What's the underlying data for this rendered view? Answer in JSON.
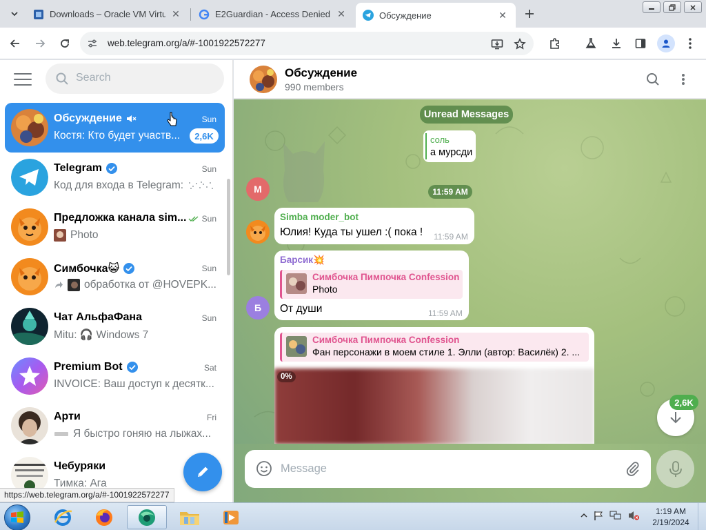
{
  "browser": {
    "tabs": [
      {
        "title": "Downloads – Oracle VM Virtua"
      },
      {
        "title": "E2Guardian - Access Denied"
      },
      {
        "title": "Обсуждение"
      }
    ],
    "url": "web.telegram.org/a/#-1001922572277",
    "status_url": "https://web.telegram.org/a/#-1001922572277"
  },
  "sidebar": {
    "search_placeholder": "Search",
    "chats": [
      {
        "name": "Обсуждение",
        "date": "Sun",
        "preview": "Костя: Кто будет участв...",
        "badge": "2,6K",
        "active": true
      },
      {
        "name": "Telegram",
        "date": "Sun",
        "preview": "Код для входа в Telegram:"
      },
      {
        "name": "Предложка канала sim...",
        "date": "Sun",
        "preview": "Photo"
      },
      {
        "name": "Симбочка😺",
        "date": "Sun",
        "preview": "обработка от @HOVEPK..."
      },
      {
        "name": "Чат АльфаФана",
        "date": "Sun",
        "preview": "Mitu: 🎧 Windows 7"
      },
      {
        "name": "Premium Bot",
        "date": "Sat",
        "preview": "INVOICE: Ваш доступ к десятк..."
      },
      {
        "name": "Арти",
        "date": "Fri",
        "preview": "Я быстро гоняю на лыжах..."
      },
      {
        "name": "Чебуряки",
        "date": "",
        "preview": "Тимка: Ага"
      }
    ]
  },
  "chat": {
    "title": "Обсуждение",
    "members": "990 members",
    "unread_label": "Unread Messages",
    "time_pill": "11:59 AM",
    "messages": [
      {
        "sender": "соль",
        "text": "а мурсди"
      },
      {
        "avatar_letter": "М"
      },
      {
        "sender": "Simba moder_bot",
        "text": "Юлия! Куда ты ушел :( пока !",
        "time": "11:59 AM"
      },
      {
        "sender": "Барсик💥",
        "reply_title": "Симбочка Пимпочка Confession",
        "reply_text": "Photo",
        "text": "От души",
        "time": "11:59 AM",
        "avatar_letter": "Б"
      },
      {
        "reply_title": "Симбочка Пимпочка Confession",
        "reply_text": "Фан персонажи в моем стиле 1. Элли (автор: Василёк) 2. ...",
        "progress": "0%"
      }
    ],
    "scroll_badge": "2,6K",
    "composer_placeholder": "Message"
  },
  "taskbar": {
    "time": "1:19 AM",
    "date": "2/19/2024"
  },
  "colors": {
    "accent": "#3390ec",
    "sender_green": "#4fae4e",
    "sender_purple": "#8e6bd1",
    "reply_pink": "#e0548f"
  }
}
